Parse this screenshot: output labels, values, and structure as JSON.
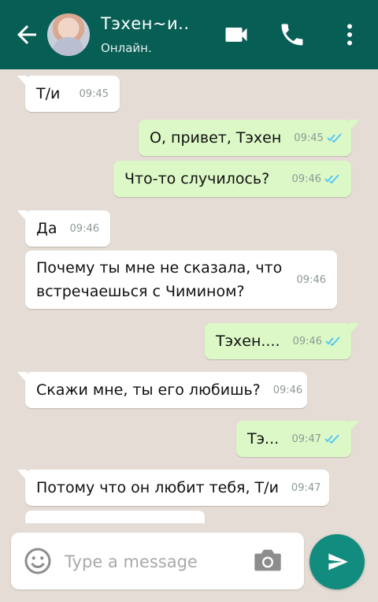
{
  "header": {
    "contact_name": "Тэхен~и..",
    "status": "Онлайн."
  },
  "messages": [
    {
      "direction": "in",
      "text": "Т/и",
      "time": "09:45"
    },
    {
      "direction": "out",
      "text": "О, привет, Тэхен",
      "time": "09:45",
      "read": true
    },
    {
      "direction": "out",
      "text": "Что-то случилось?",
      "time": "09:46",
      "read": true
    },
    {
      "direction": "in",
      "text": "Да",
      "time": "09:46"
    },
    {
      "direction": "in",
      "text": "Почему ты мне  не сказала, что встречаешься с Чимином?",
      "time": "09:46"
    },
    {
      "direction": "out",
      "text": "Тэхен....",
      "time": "09:46",
      "read": true
    },
    {
      "direction": "in",
      "text": "Скажи мне, ты его любишь?",
      "time": "09:46"
    },
    {
      "direction": "out",
      "text": "Тэ...",
      "time": "09:47",
      "read": true
    },
    {
      "direction": "in",
      "text": "Потому что он любит тебя, Т/и",
      "time": "09:47"
    }
  ],
  "composer": {
    "placeholder": "Type a message"
  },
  "icons": {
    "back": "back-arrow-icon",
    "video": "video-call-icon",
    "call": "phone-icon",
    "more": "more-vert-icon",
    "emoji": "emoji-icon",
    "camera": "camera-icon",
    "send": "send-icon",
    "read_receipt": "double-check-icon"
  },
  "colors": {
    "header": "#075e54",
    "incoming_bubble": "#ffffff",
    "outgoing_bubble": "#dcf8c6",
    "chat_background": "#e5ddd5",
    "read_tick": "#4fc3f7",
    "send_button": "#128c7e"
  }
}
